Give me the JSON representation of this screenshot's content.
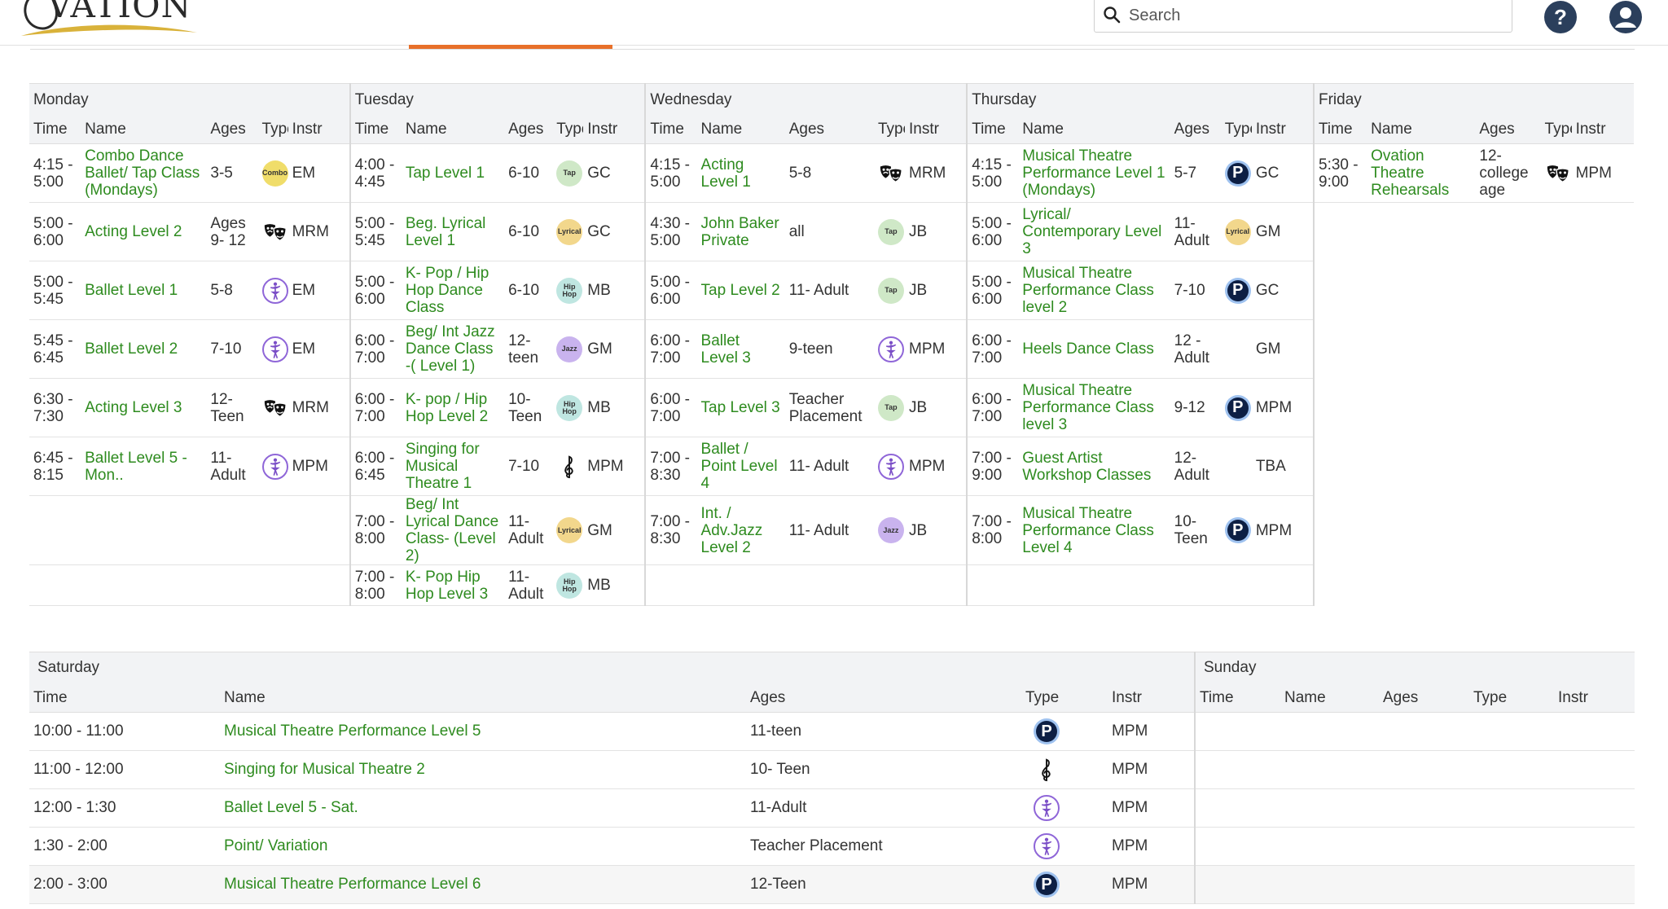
{
  "brand": {
    "logo_text": "VATION",
    "logo_initial": "O"
  },
  "search": {
    "placeholder": "Search"
  },
  "header": {
    "help_label": "?"
  },
  "icons": {
    "mask": "theatre-masks-icon",
    "clef": "treble-clef-icon",
    "ballet": "ballerina-icon",
    "p": "p-badge-icon"
  },
  "colors": {
    "class_link": "#2e8b1f",
    "tab_accent": "#e8702a",
    "header_icon": "#2b3f5c"
  },
  "weekday_columns": [
    "Time",
    "Name",
    "Ages",
    "Type",
    "Instr"
  ],
  "weekdays": [
    {
      "day": "Monday",
      "classes": [
        {
          "time": "4:15 - 5:00",
          "name": "Combo Dance Ballet/ Tap Class (Mondays)",
          "ages": "3-5",
          "type": "combo",
          "type_label": "Combo",
          "instr": "EM"
        },
        {
          "time": "5:00 - 6:00",
          "name": "Acting Level 2",
          "ages": "Ages 9- 12",
          "type": "mask",
          "type_label": "",
          "instr": "MRM"
        },
        {
          "time": "5:00 - 5:45",
          "name": "Ballet Level 1",
          "ages": "5-8",
          "type": "ballet",
          "type_label": "",
          "instr": "EM"
        },
        {
          "time": "5:45 - 6:45",
          "name": "Ballet Level 2",
          "ages": "7-10",
          "type": "ballet",
          "type_label": "",
          "instr": "EM"
        },
        {
          "time": "6:30 - 7:30",
          "name": "Acting Level 3",
          "ages": "12- Teen",
          "type": "mask",
          "type_label": "",
          "instr": "MRM"
        },
        {
          "time": "6:45 - 8:15",
          "name": "Ballet Level 5 - Mon..",
          "ages": "11- Adult",
          "type": "ballet",
          "type_label": "",
          "instr": "MPM"
        }
      ]
    },
    {
      "day": "Tuesday",
      "classes": [
        {
          "time": "4:00 - 4:45",
          "name": "Tap Level 1",
          "ages": "6-10",
          "type": "tap",
          "type_label": "Tap",
          "instr": "GC"
        },
        {
          "time": "5:00 - 5:45",
          "name": "Beg. Lyrical Level 1",
          "ages": "6-10",
          "type": "lyrical",
          "type_label": "Lyrical",
          "instr": "GC"
        },
        {
          "time": "5:00 - 6:00",
          "name": "K- Pop / Hip Hop Dance Class",
          "ages": "6-10",
          "type": "hiphop",
          "type_label": "Hip Hop",
          "instr": "MB"
        },
        {
          "time": "6:00 - 7:00",
          "name": "Beg/ Int Jazz Dance Class -( Level 1)",
          "ages": "12- teen",
          "type": "jazz",
          "type_label": "Jazz",
          "instr": "GM"
        },
        {
          "time": "6:00 - 7:00",
          "name": "K- pop / Hip Hop Level 2",
          "ages": "10- Teen",
          "type": "hiphop",
          "type_label": "Hip Hop",
          "instr": "MB"
        },
        {
          "time": "6:00 - 6:45",
          "name": "Singing for Musical Theatre 1",
          "ages": "7-10",
          "type": "clef",
          "type_label": "",
          "instr": "MPM"
        },
        {
          "time": "7:00 - 8:00",
          "name": "Beg/ Int Lyrical Dance Class- (Level 2)",
          "ages": "11- Adult",
          "type": "lyrical",
          "type_label": "Lyrical",
          "instr": "GM"
        },
        {
          "time": "7:00 - 8:00",
          "name": "K- Pop Hip Hop Level 3",
          "ages": "11- Adult",
          "type": "hiphop",
          "type_label": "Hip Hop",
          "instr": "MB"
        }
      ]
    },
    {
      "day": "Wednesday",
      "classes": [
        {
          "time": "4:15 - 5:00",
          "name": "Acting Level 1",
          "ages": "5-8",
          "type": "mask",
          "type_label": "",
          "instr": "MRM"
        },
        {
          "time": "4:30 - 5:00",
          "name": "John Baker Private",
          "ages": "all",
          "type": "tap",
          "type_label": "Tap",
          "instr": "JB"
        },
        {
          "time": "5:00 - 6:00",
          "name": "Tap Level 2",
          "ages": "11- Adult",
          "type": "tap",
          "type_label": "Tap",
          "instr": "JB"
        },
        {
          "time": "6:00 - 7:00",
          "name": "Ballet Level 3",
          "ages": "9-teen",
          "type": "ballet",
          "type_label": "",
          "instr": "MPM"
        },
        {
          "time": "6:00 - 7:00",
          "name": "Tap Level 3",
          "ages": "Teacher Placement",
          "type": "tap",
          "type_label": "Tap",
          "instr": "JB"
        },
        {
          "time": "7:00 - 8:30",
          "name": "Ballet / Point Level 4",
          "ages": "11- Adult",
          "type": "ballet",
          "type_label": "",
          "instr": "MPM"
        },
        {
          "time": "7:00 - 8:30",
          "name": "Int. / Adv.Jazz Level 2",
          "ages": "11- Adult",
          "type": "jazz",
          "type_label": "Jazz",
          "instr": "JB"
        }
      ]
    },
    {
      "day": "Thursday",
      "classes": [
        {
          "time": "4:15 - 5:00",
          "name": "Musical Theatre Performance Level 1 (Mondays)",
          "ages": "5-7",
          "type": "p",
          "type_label": "P",
          "instr": "GC"
        },
        {
          "time": "5:00 - 6:00",
          "name": "Lyrical/ Contemporary Level 3",
          "ages": "11- Adult",
          "type": "lyrical",
          "type_label": "Lyrical",
          "instr": "GM"
        },
        {
          "time": "5:00 - 6:00",
          "name": "Musical Theatre Performance Class level 2",
          "ages": "7-10",
          "type": "p",
          "type_label": "P",
          "instr": "GC"
        },
        {
          "time": "6:00 - 7:00",
          "name": "Heels Dance Class",
          "ages": "12 - Adult",
          "type": "",
          "type_label": "",
          "instr": "GM"
        },
        {
          "time": "6:00 - 7:00",
          "name": "Musical Theatre Performance Class level 3",
          "ages": "9-12",
          "type": "p",
          "type_label": "P",
          "instr": "MPM"
        },
        {
          "time": "7:00 - 9:00",
          "name": "Guest Artist Workshop Classes",
          "ages": "12- Adult",
          "type": "",
          "type_label": "",
          "instr": "TBA"
        },
        {
          "time": "7:00 - 8:00",
          "name": "Musical Theatre Performance Class Level 4",
          "ages": "10- Teen",
          "type": "p",
          "type_label": "P",
          "instr": "MPM"
        }
      ]
    },
    {
      "day": "Friday",
      "classes": [
        {
          "time": "5:30 - 9:00",
          "name": "Ovation Theatre Rehearsals",
          "ages": "12- college age",
          "type": "mask",
          "type_label": "",
          "instr": "MPM"
        }
      ]
    }
  ],
  "saturday": {
    "day": "Saturday",
    "columns": [
      "Time",
      "Name",
      "Ages",
      "Type",
      "Instr"
    ],
    "classes": [
      {
        "time": "10:00 - 11:00",
        "name": "Musical Theatre Performance Level 5",
        "ages": "11-teen",
        "type": "p",
        "type_label": "P",
        "instr": "MPM"
      },
      {
        "time": "11:00 - 12:00",
        "name": "Singing for Musical Theatre 2",
        "ages": "10- Teen",
        "type": "clef",
        "type_label": "",
        "instr": "MPM"
      },
      {
        "time": "12:00 - 1:30",
        "name": "Ballet Level 5 - Sat.",
        "ages": "11-Adult",
        "type": "ballet",
        "type_label": "",
        "instr": "MPM"
      },
      {
        "time": "1:30 - 2:00",
        "name": "Point/ Variation",
        "ages": "Teacher Placement",
        "type": "ballet",
        "type_label": "",
        "instr": "MPM"
      },
      {
        "time": "2:00 - 3:00",
        "name": "Musical Theatre Performance Level 6",
        "ages": "12-Teen",
        "type": "p",
        "type_label": "P",
        "instr": "MPM"
      }
    ]
  },
  "sunday": {
    "day": "Sunday",
    "columns": [
      "Time",
      "Name",
      "Ages",
      "Type",
      "Instr"
    ],
    "classes": []
  }
}
